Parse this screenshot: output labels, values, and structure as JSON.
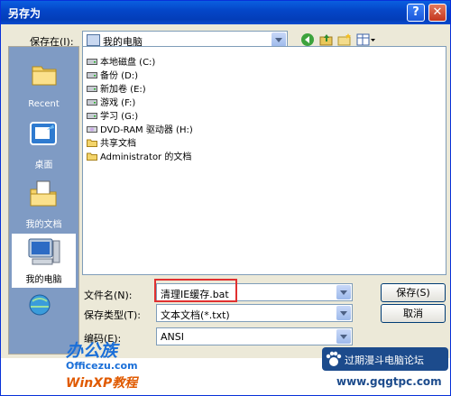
{
  "window": {
    "title": "另存为",
    "help_label": "?",
    "close_label": "✕"
  },
  "save_in": {
    "label": "保存在(I):",
    "value": "我的电脑"
  },
  "places": [
    {
      "label": "Recent",
      "icon": "recent-folder-icon"
    },
    {
      "label": "桌面",
      "icon": "desktop-icon"
    },
    {
      "label": "我的文档",
      "icon": "my-documents-icon"
    },
    {
      "label": "我的电脑",
      "icon": "my-computer-icon"
    }
  ],
  "files": [
    {
      "label": "本地磁盘 (C:)",
      "icon": "drive-icon"
    },
    {
      "label": "备份 (D:)",
      "icon": "drive-icon"
    },
    {
      "label": "新加卷 (E:)",
      "icon": "drive-icon"
    },
    {
      "label": "游戏 (F:)",
      "icon": "drive-icon"
    },
    {
      "label": "学习 (G:)",
      "icon": "drive-icon"
    },
    {
      "label": "DVD-RAM 驱动器 (H:)",
      "icon": "dvd-drive-icon"
    },
    {
      "label": "共享文档",
      "icon": "folder-icon"
    },
    {
      "label": "Administrator 的文档",
      "icon": "folder-icon"
    }
  ],
  "filename": {
    "label": "文件名(N):",
    "value": "清理IE缓存.bat"
  },
  "filetype": {
    "label": "保存类型(T):",
    "value": "文本文档(*.txt)"
  },
  "encoding": {
    "label": "编码(E):",
    "value": "ANSI"
  },
  "buttons": {
    "save": "保存(S)",
    "cancel": "取消"
  },
  "watermarks": {
    "brand_cn": "办公族",
    "brand_url": "Officezu.com",
    "brand_xp": "WinXP教程",
    "forum": "过期漫斗电脑论坛",
    "forum_url": "www.gqgtpc.com"
  },
  "colors": {
    "titlebar": "#0446C8",
    "highlight_box": "#E03030"
  }
}
